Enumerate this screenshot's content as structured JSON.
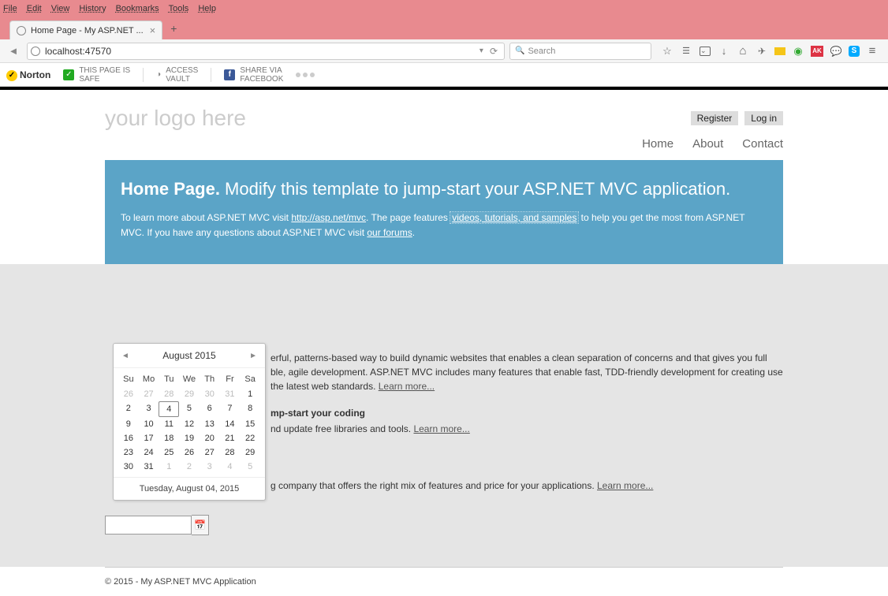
{
  "browser": {
    "menus": [
      "File",
      "Edit",
      "View",
      "History",
      "Bookmarks",
      "Tools",
      "Help"
    ],
    "tab_title": "Home Page - My ASP.NET ...",
    "url": "localhost:47570",
    "search_placeholder": "Search",
    "ak_label": "AK",
    "skype_label": "S"
  },
  "norton": {
    "brand": "Norton",
    "safe_line1": "THIS PAGE IS",
    "safe_line2": "SAFE",
    "access_line1": "ACCESS",
    "access_line2": "VAULT",
    "share_line1": "SHARE VIA",
    "share_line2": "FACEBOOK",
    "fb": "f"
  },
  "page": {
    "logo": "your logo here",
    "register": "Register",
    "login": "Log in",
    "nav": {
      "home": "Home",
      "about": "About",
      "contact": "Contact"
    },
    "hero_title_bold": "Home Page.",
    "hero_title_rest": " Modify this template to jump-start your ASP.NET MVC application.",
    "hero_p1a": "To learn more about ASP.NET MVC visit ",
    "hero_link1": "http://asp.net/mvc",
    "hero_p1b": ". The page features ",
    "hero_link2": "videos, tutorials, and samples",
    "hero_p1c": " to help you get the most from ASP.NET MVC. If you have any questions about ASP.NET MVC visit ",
    "hero_link3": "our forums",
    "hero_p1d": ".",
    "sec1_body": "erful, patterns-based way to build dynamic websites that enables a clean separation of concerns and that gives you full ble, agile development. ASP.NET MVC includes many features that enable fast, TDD-friendly development for creating use the latest web standards. ",
    "learn_more": "Learn more...",
    "sec2_head": "mp-start your coding",
    "sec2_body": "nd update free libraries and tools. ",
    "sec3_body": "g company that offers the right mix of features and price for your applications. ",
    "footer": "© 2015 - My ASP.NET MVC Application"
  },
  "calendar": {
    "title": "August 2015",
    "dayheads": [
      "Su",
      "Mo",
      "Tu",
      "We",
      "Th",
      "Fr",
      "Sa"
    ],
    "weeks": [
      [
        {
          "d": "26",
          "o": true
        },
        {
          "d": "27",
          "o": true
        },
        {
          "d": "28",
          "o": true
        },
        {
          "d": "29",
          "o": true
        },
        {
          "d": "30",
          "o": true
        },
        {
          "d": "31",
          "o": true
        },
        {
          "d": "1"
        }
      ],
      [
        {
          "d": "2"
        },
        {
          "d": "3"
        },
        {
          "d": "4",
          "sel": true
        },
        {
          "d": "5"
        },
        {
          "d": "6"
        },
        {
          "d": "7"
        },
        {
          "d": "8"
        }
      ],
      [
        {
          "d": "9"
        },
        {
          "d": "10"
        },
        {
          "d": "11"
        },
        {
          "d": "12"
        },
        {
          "d": "13"
        },
        {
          "d": "14"
        },
        {
          "d": "15"
        }
      ],
      [
        {
          "d": "16"
        },
        {
          "d": "17"
        },
        {
          "d": "18"
        },
        {
          "d": "19"
        },
        {
          "d": "20"
        },
        {
          "d": "21"
        },
        {
          "d": "22"
        }
      ],
      [
        {
          "d": "23"
        },
        {
          "d": "24"
        },
        {
          "d": "25"
        },
        {
          "d": "26"
        },
        {
          "d": "27"
        },
        {
          "d": "28"
        },
        {
          "d": "29"
        }
      ],
      [
        {
          "d": "30"
        },
        {
          "d": "31"
        },
        {
          "d": "1",
          "o": true
        },
        {
          "d": "2",
          "o": true
        },
        {
          "d": "3",
          "o": true
        },
        {
          "d": "4",
          "o": true
        },
        {
          "d": "5",
          "o": true
        }
      ]
    ],
    "footer": "Tuesday, August 04, 2015"
  }
}
